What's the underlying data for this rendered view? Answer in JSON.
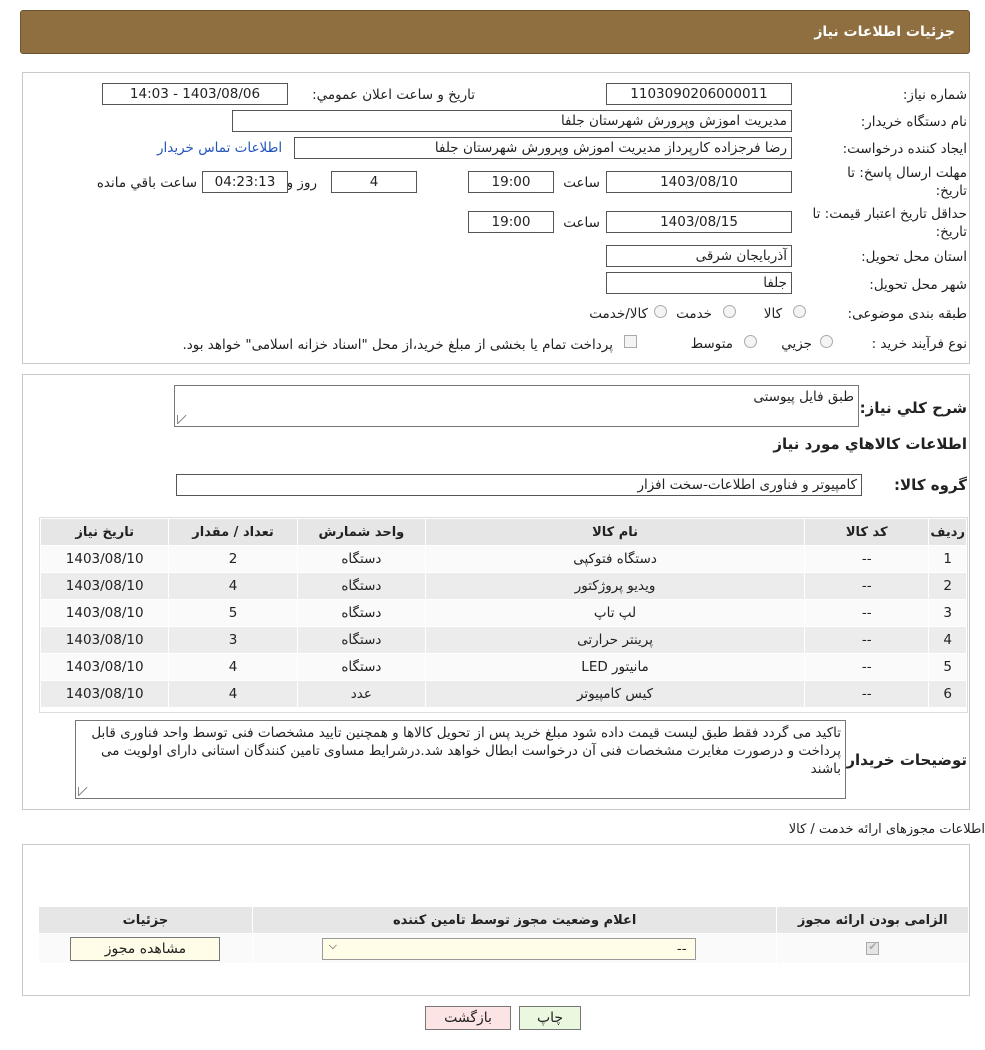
{
  "header": {
    "title": "جزئیات اطلاعات نیاز"
  },
  "info": {
    "need_number_label": "شماره نیاز:",
    "need_number": "1103090206000011",
    "announce_label": "تاریخ و ساعت اعلان عمومي:",
    "announce_value": "1403/08/06 - 14:03",
    "buyer_org_label": "نام دستگاه خریدار:",
    "buyer_org": "مدیریت اموزش وپرورش شهرستان جلفا",
    "creator_label": "ایجاد کننده درخواست:",
    "creator": "رضا فرجزاده کارپرداز مدیریت اموزش وپرورش شهرستان جلفا",
    "contact_link": "اطلاعات تماس خریدار",
    "deadline_label_1": "مهلت ارسال پاسخ: تا",
    "deadline_label_2": "تاریخ:",
    "deadline_date": "1403/08/10",
    "time_label": "ساعت",
    "deadline_time": "19:00",
    "days_value": "4",
    "days_label": "روز و",
    "remaining_value": "04:23:13",
    "remaining_label": "ساعت باقي مانده",
    "validity_label_1": "حداقل تاریخ اعتبار قیمت: تا",
    "validity_label_2": "تاریخ:",
    "validity_date": "1403/08/15",
    "validity_time": "19:00",
    "province_label": "استان محل تحویل:",
    "province": "آذربایجان شرقی",
    "city_label": "شهر محل تحویل:",
    "city": "جلفا",
    "category_label": "طبقه بندی موضوعی:",
    "category_options": [
      "کالا",
      "خدمت",
      "کالا/خدمت"
    ],
    "process_label": "نوع فرآیند خرید :",
    "process_options": [
      "جزیي",
      "متوسط"
    ],
    "payment_note": "پرداخت تمام یا بخشی از مبلغ خرید،از محل \"اسناد خزانه اسلامی\" خواهد بود."
  },
  "summary": {
    "desc_label": "شرح کلي نیاز:",
    "desc_value": "طبق فایل پیوستی",
    "goods_heading": "اطلاعات کالاهاي مورد نیاز",
    "group_label": "گروه کالا:",
    "group_value": "کامپیوتر و فناوری اطلاعات-سخت افزار"
  },
  "goods_table": {
    "headers": [
      "ردیف",
      "کد کالا",
      "نام کالا",
      "واحد شمارش",
      "تعداد / مقدار",
      "تاریخ نیاز"
    ],
    "rows": [
      [
        "1",
        "--",
        "دستگاه فتوکپی",
        "دستگاه",
        "2",
        "1403/08/10"
      ],
      [
        "2",
        "--",
        "ویدیو پروژکتور",
        "دستگاه",
        "4",
        "1403/08/10"
      ],
      [
        "3",
        "--",
        "لپ تاپ",
        "دستگاه",
        "5",
        "1403/08/10"
      ],
      [
        "4",
        "--",
        "پرینتر حرارتی",
        "دستگاه",
        "3",
        "1403/08/10"
      ],
      [
        "5",
        "--",
        "مانیتور LED",
        "دستگاه",
        "4",
        "1403/08/10"
      ],
      [
        "6",
        "--",
        "کیس کامپیوتر",
        "عدد",
        "4",
        "1403/08/10"
      ]
    ]
  },
  "buyer_notes": {
    "label": "توضیحات خریدار:",
    "text": "تاکید می گردد فقط طبق لیست قیمت داده شود مبلغ خرید پس از تحویل کالاها و همچنین تایید مشخصات فنی توسط واحد فناوری قابل پرداخت و درصورت مغایرت مشخصات فنی آن درخواست ابطال خواهد شد.درشرایط مساوی تامین کنندگان استانی دارای اولویت می باشند"
  },
  "permits": {
    "title": "اطلاعات مجوزهای ارائه خدمت / کالا",
    "headers": [
      "الزامی بودن ارائه مجوز",
      "اعلام وضعیت مجوز توسط تامین کننده",
      "جزئیات"
    ],
    "select_value": "--",
    "view_button": "مشاهده مجوز"
  },
  "buttons": {
    "print": "چاپ",
    "back": "بازگشت"
  },
  "colors": {
    "header_bg": "#8f6f3f",
    "link": "#2255bb",
    "back_btn_bg": "#fce4e4",
    "print_btn_bg": "#eaf8e0"
  }
}
